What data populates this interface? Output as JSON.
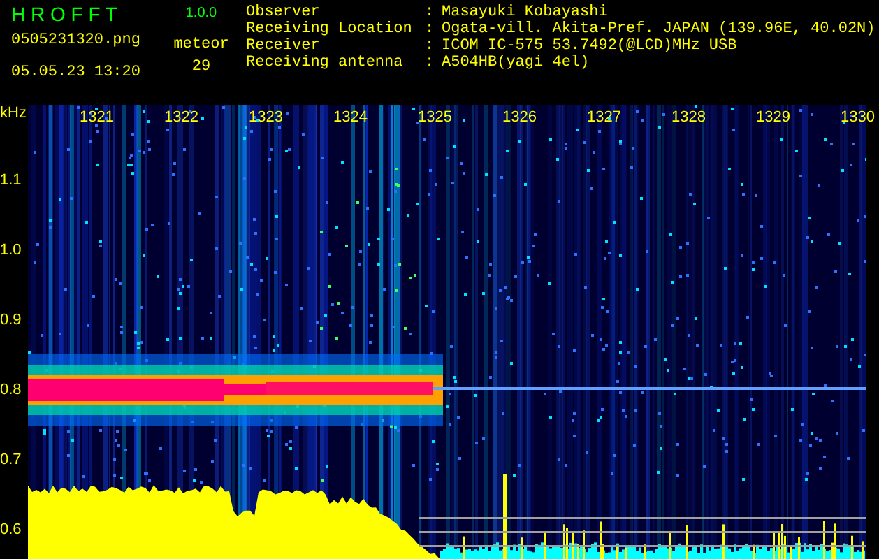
{
  "app_title": "H R O F F T",
  "version": "1.0.0",
  "filename": "0505231320.png",
  "datetime": "05.05.23 13:20",
  "meteor_label": "meteor",
  "meteor_count": "29",
  "info": [
    {
      "label": "Observer",
      "value": "Masayuki Kobayashi"
    },
    {
      "label": "Receiving Location",
      "value": "Ogata-vill. Akita-Pref. JAPAN (139.96E, 40.02N)"
    },
    {
      "label": "Receiver",
      "value": "ICOM IC-575 53.7492(@LCD)MHz USB"
    },
    {
      "label": "Receiving antenna",
      "value": "A504HB(yagi 4el)"
    }
  ],
  "separator": ":",
  "y_unit": "kHz",
  "y_ticks": [
    "1.1",
    "1.0",
    "0.9",
    "0.8",
    "0.7",
    "0.6"
  ],
  "time_labels": [
    "1321",
    "1322",
    "1323",
    "1324",
    "1325",
    "1326",
    "1327",
    "1328",
    "1329",
    "1330"
  ]
}
